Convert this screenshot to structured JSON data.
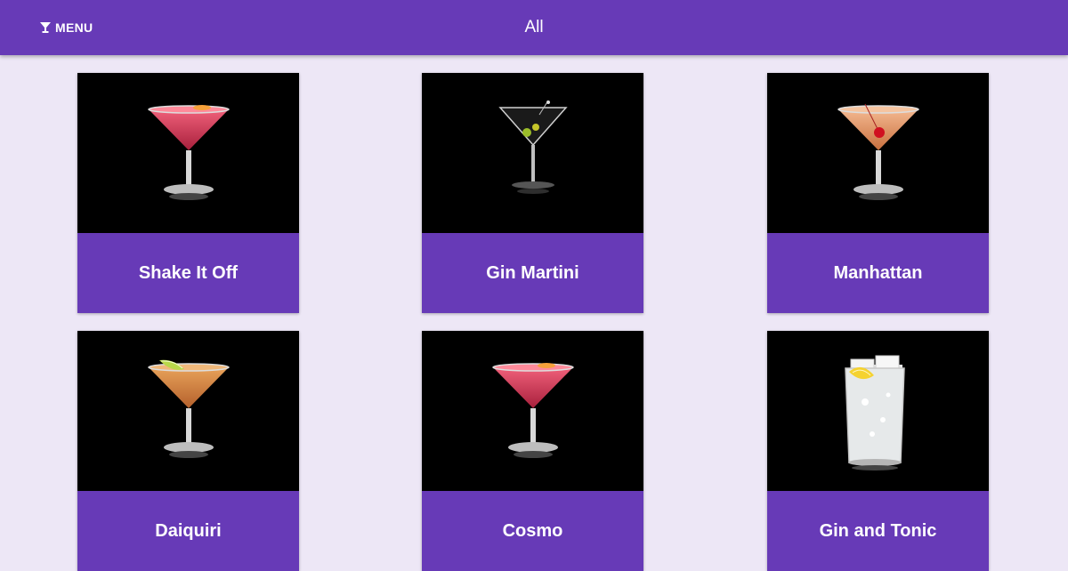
{
  "header": {
    "menu_label": "MENU",
    "menu_icon": "cocktail-icon",
    "title": "All",
    "color": "#673ab7"
  },
  "colors": {
    "background": "#ede7f6",
    "card_label": "#673ab7",
    "thumb": "#000000"
  },
  "cocktails": [
    {
      "name": "Shake It Off",
      "image": "red-martini-glass"
    },
    {
      "name": "Gin Martini",
      "image": "clear-martini-with-olive"
    },
    {
      "name": "Manhattan",
      "image": "amber-martini-with-cherry"
    },
    {
      "name": "Daiquiri",
      "image": "orange-martini-with-lime"
    },
    {
      "name": "Cosmo",
      "image": "red-martini-glass"
    },
    {
      "name": "Gin and Tonic",
      "image": "highball-with-ice-and-lemon"
    }
  ]
}
